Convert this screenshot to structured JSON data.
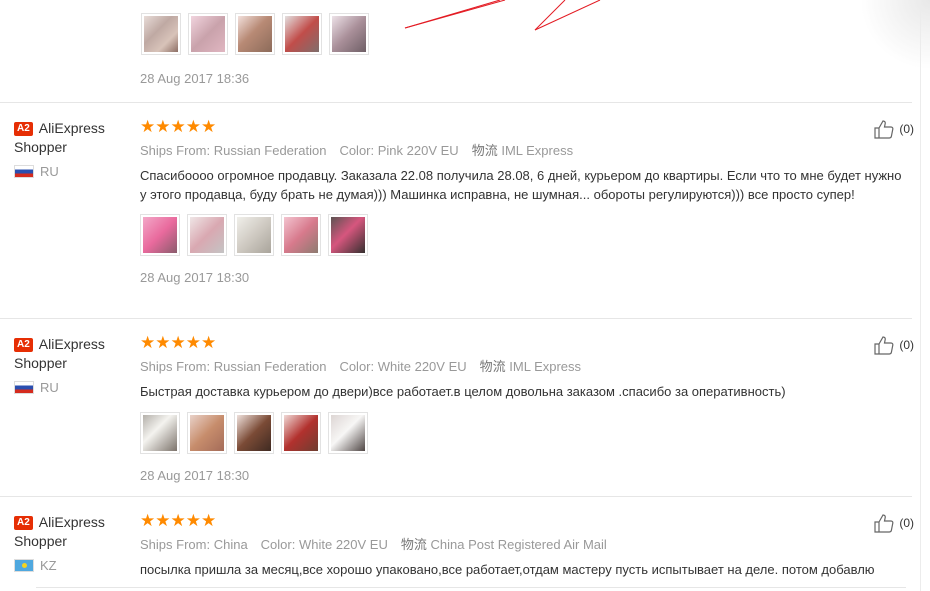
{
  "top_fragment": {
    "date": "28 Aug 2017 18:36",
    "thumbs": [
      "ph1",
      "ph2",
      "ph3",
      "ph4",
      "ph5"
    ]
  },
  "labels": {
    "ships_from": "Ships From:",
    "color": "Color:",
    "shipping_icon": "物流"
  },
  "stars_text": "★★★★★",
  "accent_color": "#e62e04",
  "star_color": "#ff8a00",
  "reviews": [
    {
      "badge": "A2",
      "user": "AliExpress",
      "user2": "Shopper",
      "country": "RU",
      "flag": "russia-flag-icon",
      "rating": 5,
      "ships_from": "Russian Federation",
      "color": "Pink 220V EU",
      "shipping": "IML Express",
      "text": "Спасибоооо огромное продавцу. Заказала 22.08 получила 28.08, 6 дней, курьером до квартиры. Если что то мне будет нужно у этого продавца, буду брать не думая))) Машинка исправна, не шумная... обороты регулируются))) все просто супер!",
      "thumbs": [
        "ph6",
        "ph7",
        "ph8",
        "ph9",
        "ph10"
      ],
      "date": "28 Aug 2017 18:30",
      "likes": "(0)"
    },
    {
      "badge": "A2",
      "user": "AliExpress",
      "user2": "Shopper",
      "country": "RU",
      "flag": "russia-flag-icon",
      "rating": 5,
      "ships_from": "Russian Federation",
      "color": "White 220V EU",
      "shipping": "IML Express",
      "text": "Быстрая доставка курьером до двери)все работает.в целом довольна заказом .спасибо за оперативность)",
      "thumbs": [
        "ph11",
        "ph12",
        "ph13",
        "ph14",
        "ph15"
      ],
      "date": "28 Aug 2017 18:30",
      "likes": "(0)"
    },
    {
      "badge": "A2",
      "user": "AliExpress",
      "user2": "Shopper",
      "country": "KZ",
      "flag": "kazakhstan-flag-icon",
      "rating": 5,
      "ships_from": "China",
      "color": "White 220V EU",
      "shipping": "China Post Registered Air Mail",
      "text": "посылка пришла за месяц,все хорошо упаковано,все работает,отдам мастеру пусть испытывает на деле. потом добавлю",
      "thumbs": [],
      "date": "",
      "likes": "(0)"
    }
  ]
}
